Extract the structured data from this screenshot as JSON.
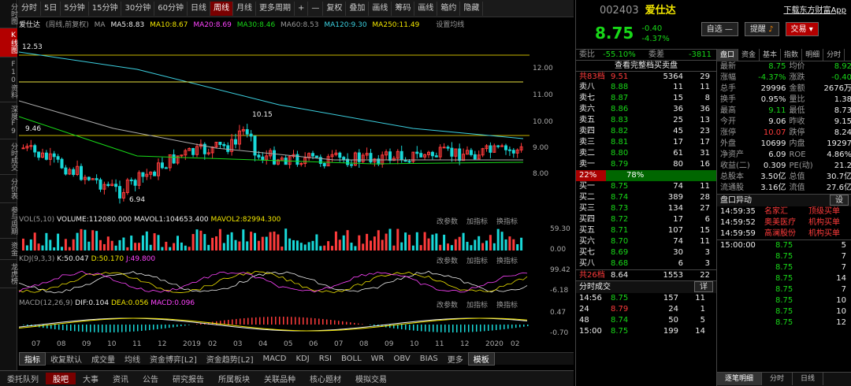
{
  "left_tabs": [
    "分时图",
    "K线图",
    "F10资料",
    "深度F9",
    "分时成交",
    "分价表",
    "参与周期",
    "资金",
    "龙虎榜"
  ],
  "toolbar": [
    "分时",
    "5日",
    "5分钟",
    "15分钟",
    "30分钟",
    "60分钟",
    "日线",
    "周线",
    "月线",
    "更多周期",
    "+",
    "—",
    "复权",
    "叠加",
    "画线",
    "筹码",
    "画线",
    "箱约",
    "隐藏"
  ],
  "toolbar_active": "周线",
  "info": {
    "name": "爱仕达",
    "mode": "(周线,前复权)",
    "ma": "MA",
    "ma5": "MA5:8.83",
    "ma10": "MA10:8.67",
    "ma20": "MA20:8.69",
    "ma30": "MA30:8.46",
    "ma60": "MA60:8.53",
    "ma120": "MA120:9.30",
    "ma250": "MA250:11.49",
    "settings": "设置均线"
  },
  "chart": {
    "label_high": "12.53",
    "label_mid": "10.15",
    "label_left": "9.46",
    "label_low": "6.94",
    "yticks": [
      "12.00",
      "11.00",
      "10.00",
      "9.00",
      "8.00"
    ]
  },
  "vol": {
    "title": "VOL(5,10)",
    "volume": "VOLUME:112080.000",
    "mavol1": "MAVOL1:104653.400",
    "mavol2": "MAVOL2:82994.300",
    "params": "改参数",
    "add": "加指标",
    "swap": "换指标",
    "y": [
      "59.30",
      "0.00"
    ]
  },
  "kdj": {
    "title": "KDJ(9,3,3)",
    "k": "K:50.047",
    "d": "D:50.170",
    "j": "J:49.800",
    "y": [
      "99.42",
      "-6.18"
    ]
  },
  "macd": {
    "title": "MACD(12,26,9)",
    "dif": "DIF:0.104",
    "dea": "DEA:0.056",
    "macd": "MACD:0.096",
    "y": [
      "0.47",
      "-0.70"
    ]
  },
  "xaxis": [
    "07",
    "08",
    "09",
    "10",
    "11",
    "12",
    "2019",
    "02",
    "03",
    "04",
    "05",
    "06",
    "07",
    "08",
    "09",
    "10",
    "11",
    "12",
    "2020",
    "02"
  ],
  "indicators": [
    "指标",
    "收复默认",
    "成交量",
    "均线",
    "资金博弈[L2]",
    "资金趋势[L2]",
    "MACD",
    "KDJ",
    "RSI",
    "BOLL",
    "WR",
    "OBV",
    "BIAS",
    "更多",
    "模板"
  ],
  "bottom_tabs": [
    "委托队列",
    "股吧",
    "大事",
    "资讯",
    "公告",
    "研究报告",
    "所属板块",
    "关联品种",
    "核心题材",
    "模拟交易"
  ],
  "stock": {
    "code": "002403",
    "name": "爱仕达",
    "link": "下载东方财富App",
    "price": "8.75",
    "change": "-0.40",
    "pct": "-4.37%",
    "btn_self": "自选",
    "btn_alert": "提醒",
    "btn_trade": "交易"
  },
  "webi": {
    "l1": "委比",
    "v1": "-55.10%",
    "l2": "委差",
    "v2": "-3811",
    "view_all": "查看完整档买卖盘",
    "total_label": "共83档",
    "total_price": "9.51",
    "total_vol": "5364",
    "total_n": "29"
  },
  "sells": [
    [
      "卖八",
      "8.88",
      "11",
      "11"
    ],
    [
      "卖七",
      "8.87",
      "15",
      "8"
    ],
    [
      "卖六",
      "8.86",
      "36",
      "36"
    ],
    [
      "卖五",
      "8.83",
      "25",
      "13"
    ],
    [
      "卖四",
      "8.82",
      "45",
      "23"
    ],
    [
      "卖三",
      "8.81",
      "17",
      "17"
    ],
    [
      "卖二",
      "8.80",
      "61",
      "31"
    ],
    [
      "卖一",
      "8.79",
      "80",
      "16"
    ]
  ],
  "ratio": {
    "buy": "22%",
    "sell": "78%"
  },
  "buys": [
    [
      "买一",
      "8.75",
      "74",
      "11"
    ],
    [
      "买二",
      "8.74",
      "389",
      "28"
    ],
    [
      "买三",
      "8.73",
      "134",
      "27"
    ],
    [
      "买四",
      "8.72",
      "17",
      "6"
    ],
    [
      "买五",
      "8.71",
      "107",
      "15"
    ],
    [
      "买六",
      "8.70",
      "74",
      "11"
    ],
    [
      "买七",
      "8.69",
      "30",
      "3"
    ],
    [
      "买八",
      "8.68",
      "6",
      "3"
    ]
  ],
  "buy_total": {
    "label": "共26档",
    "price": "8.64",
    "vol": "1553",
    "n": "22"
  },
  "ticks_title": "分时成交",
  "ticks_detail": "详",
  "ticks": [
    [
      "14:56",
      "8.75",
      "157",
      "11"
    ],
    [
      "24",
      "8.79",
      "24",
      "1"
    ],
    [
      "48",
      "8.74",
      "50",
      "5"
    ],
    [
      "15:00",
      "8.75",
      "199",
      "14"
    ]
  ],
  "pan_tabs": [
    "盘口",
    "资金",
    "基本",
    "指数",
    "明细",
    "分时"
  ],
  "pan": [
    [
      "最新",
      "8.75",
      "均价",
      "8.92"
    ],
    [
      "涨幅",
      "-4.37%",
      "涨跌",
      "-0.40"
    ],
    [
      "总手",
      "29996",
      "金额",
      "2676万"
    ],
    [
      "换手",
      "0.95%",
      "量比",
      "1.38"
    ],
    [
      "最高",
      "9.11",
      "最低",
      "8.73"
    ],
    [
      "今开",
      "9.06",
      "昨收",
      "9.15"
    ],
    [
      "涨停",
      "10.07",
      "跌停",
      "8.24"
    ],
    [
      "外盘",
      "10699",
      "内盘",
      "19297"
    ],
    [
      "净资产",
      "6.09",
      "ROE",
      "4.86%"
    ],
    [
      "收益(二)",
      "0.309",
      "PE(动)",
      "21.2"
    ],
    [
      "总股本",
      "3.50亿",
      "总值",
      "30.7亿"
    ],
    [
      "流通股",
      "3.16亿",
      "流值",
      "27.6亿"
    ]
  ],
  "alert_title": "盘口异动",
  "alert_btn": "设",
  "alerts": [
    [
      "14:59:35",
      "名家汇",
      "顶级买单"
    ],
    [
      "14:59:52",
      "奥美医疗",
      "机构买单"
    ],
    [
      "14:59:59",
      "高澜股份",
      "机构买单"
    ]
  ],
  "detail": [
    [
      "15:00:00",
      "8.75",
      "5"
    ],
    [
      "",
      "8.75",
      "7"
    ],
    [
      "",
      "8.75",
      "7"
    ],
    [
      "",
      "8.75",
      "14"
    ],
    [
      "",
      "8.75",
      "7"
    ],
    [
      "",
      "8.75",
      "10"
    ],
    [
      "",
      "8.75",
      "10"
    ],
    [
      "",
      "8.75",
      "12"
    ]
  ],
  "right_bottom_tabs": [
    "逐笔明细",
    "分时",
    "日线"
  ]
}
